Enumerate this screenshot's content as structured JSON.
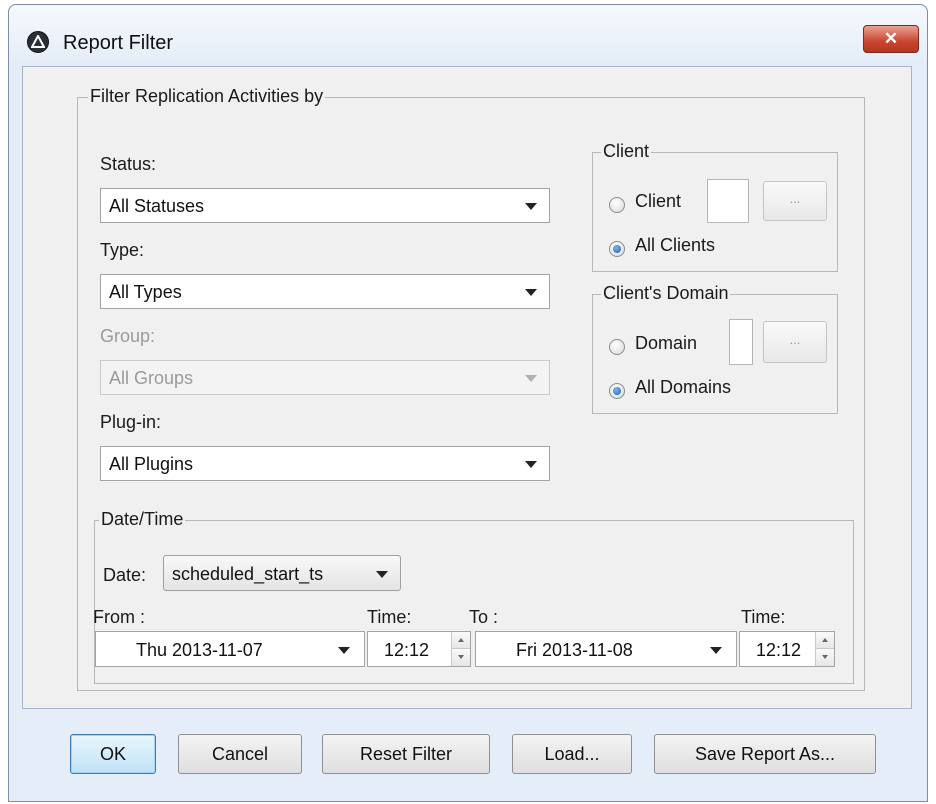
{
  "window": {
    "title": "Report Filter",
    "close_glyph": "✕"
  },
  "filter_group": {
    "legend": "Filter Replication Activities by",
    "status": {
      "label": "Status:",
      "value": "All Statuses"
    },
    "type": {
      "label": "Type:",
      "value": "All Types"
    },
    "group": {
      "label": "Group:",
      "value": "All Groups",
      "enabled": false
    },
    "plugin": {
      "label": "Plug-in:",
      "value": "All Plugins"
    }
  },
  "client_group": {
    "legend": "Client",
    "radio_client_label": "Client",
    "radio_all_label": "All Clients",
    "selected": "All Clients",
    "browse_label": "..."
  },
  "domain_group": {
    "legend": "Client's Domain",
    "radio_domain_label": "Domain",
    "radio_all_label": "All Domains",
    "selected": "All Domains",
    "browse_label": "..."
  },
  "datetime_group": {
    "legend": "Date/Time",
    "date_label": "Date:",
    "date_field": "scheduled_start_ts",
    "from_label": "From :",
    "from_date": "Thu 2013-11-07",
    "from_time_label": "Time:",
    "from_time": "12:12",
    "to_label": "To :",
    "to_date": "Fri 2013-11-08",
    "to_time_label": "Time:",
    "to_time": "12:12"
  },
  "buttons": {
    "ok": "OK",
    "cancel": "Cancel",
    "reset": "Reset Filter",
    "load": "Load...",
    "save": "Save Report As..."
  },
  "colors": {
    "frame": "#e5eef8",
    "panel": "#f0f0f0",
    "default_button": "#bfe2f7",
    "radio_selected": "#1f5fb0"
  }
}
